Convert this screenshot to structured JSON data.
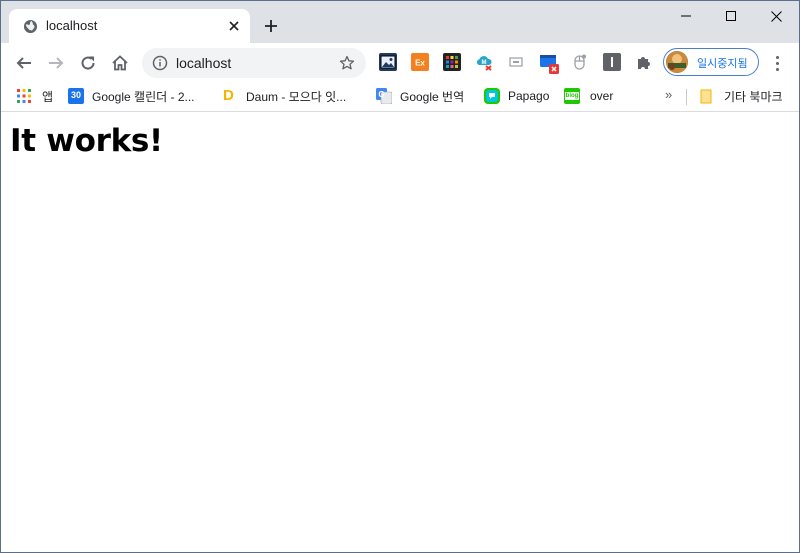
{
  "tab": {
    "title": "localhost",
    "favicon": "globe-icon"
  },
  "new_tab_label": "+",
  "address_bar": {
    "url": "localhost"
  },
  "profile": {
    "label": "일시중지됨"
  },
  "bookmarks": {
    "apps": "앱",
    "items": [
      {
        "label": "Google 캘린더 - 2...",
        "icon": "google-calendar-icon",
        "badge": "30"
      },
      {
        "label": "Daum - 모으다 잇...",
        "icon": "daum-icon",
        "badge": "D"
      },
      {
        "label": "Google 번역",
        "icon": "google-translate-icon"
      },
      {
        "label": "Papago",
        "icon": "papago-icon"
      },
      {
        "label": "over",
        "icon": "blog-icon",
        "badge": "blog"
      }
    ],
    "more": "»",
    "other_folder": "기타 북마크"
  },
  "page": {
    "heading": "It works!"
  },
  "colors": {
    "tabstrip": "#dee1e6",
    "accent": "#1a73e8"
  }
}
